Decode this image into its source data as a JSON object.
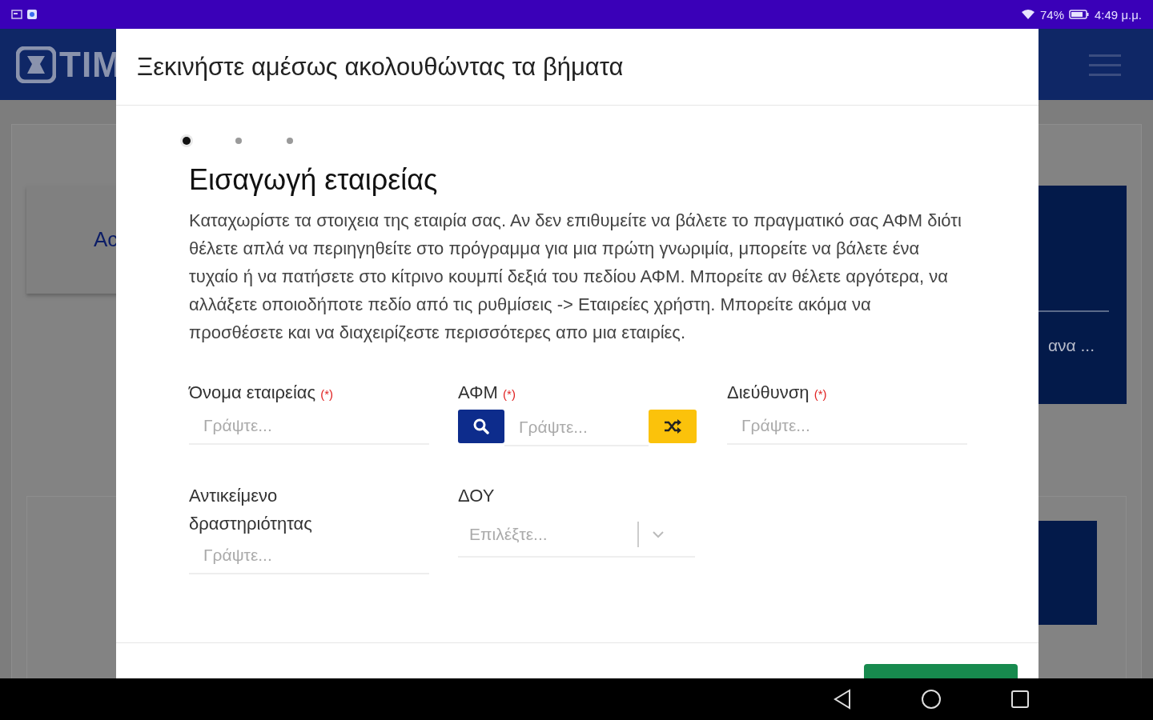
{
  "status_bar": {
    "battery": "74%",
    "time": "4:49 μ.μ."
  },
  "app_header": {
    "logo_text": "TIM"
  },
  "background": {
    "left_card_text": "Ac",
    "right_panel_text": "ανα ..."
  },
  "dialog": {
    "title": "Ξεκινήστε αμέσως ακολουθώντας τα βήματα",
    "steps": [
      {
        "selected": true
      },
      {
        "selected": false
      },
      {
        "selected": false
      }
    ],
    "heading": "Εισαγωγή εταιρείας",
    "description": "Καταχωρίστε τα στοιχεια της εταιρία σας. Αν δεν επιθυμείτε να βάλετε το πραγματικό σας ΑΦΜ διότι θέλετε απλά να περιηγηθείτε στο πρόγραμμα για μια πρώτη γνωριμία, μπορείτε να βάλετε ένα τυχαίο ή να πατήσετε στο κίτρινο κουμπί δεξιά του πεδίου ΑΦΜ. Μπορείτε αν θέλετε αργότερα, να αλλάξετε οποιοδήποτε πεδίο από τις ρυθμίσεις -> Εταιρείες χρήστη. Μπορείτε ακόμα να προσθέσετε και να διαχειρίζεστε περισσότερες απο μια εταιρίες.",
    "fields": [
      {
        "kind": "text",
        "label": "Όνομα εταιρείας",
        "required_mark": "(*)",
        "placeholder": "Γράψτε..."
      },
      {
        "kind": "afm",
        "label": "ΑΦΜ",
        "required_mark": "(*)",
        "placeholder": "Γράψτε..."
      },
      {
        "kind": "text",
        "label": "Διεύθυνση",
        "required_mark": "(*)",
        "placeholder": "Γράψτε..."
      },
      {
        "kind": "text",
        "label": "Αντικείμενο δραστηριότητας",
        "placeholder": "Γράψτε..."
      },
      {
        "kind": "select",
        "label": "ΔΟΥ",
        "placeholder": "Επιλέξτε..."
      }
    ]
  }
}
